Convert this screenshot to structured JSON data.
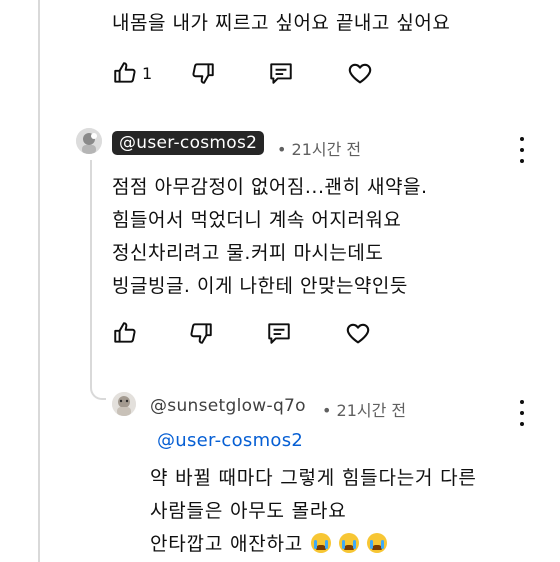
{
  "top_comment": {
    "text_line": "내몸을 내가 찌르고 싶어요 끝내고 싶어요",
    "like_count": "1"
  },
  "comment_cosmos": {
    "handle": "@user-cosmos2",
    "time": "• 21시간 전",
    "lines": [
      "점점 아무감정이 없어짐...괜히 새약을.",
      "힘들어서 먹었더니 계속 어지러워요",
      "정신차리려고 물.커피 마시는데도",
      "빙글빙글. 이게 나한테 안맞는약인듯"
    ]
  },
  "reply_sunset": {
    "handle": "@sunsetglow-q7o",
    "time": "• 21시간 전",
    "mention": "@user-cosmos2",
    "lines": [
      "약 바뀔 때마다 그렇게 힘들다는거 다른",
      "사람들은 아무도 몰라요",
      "안타깝고 애잔하고"
    ],
    "emoji_icon": "loudly-crying-face-icon"
  },
  "colors": {
    "text": "#0f0f0f",
    "meta": "#606060",
    "mention": "#065fd4",
    "handle_badge_bg": "#262626",
    "thread_line": "#d9d9d9"
  }
}
